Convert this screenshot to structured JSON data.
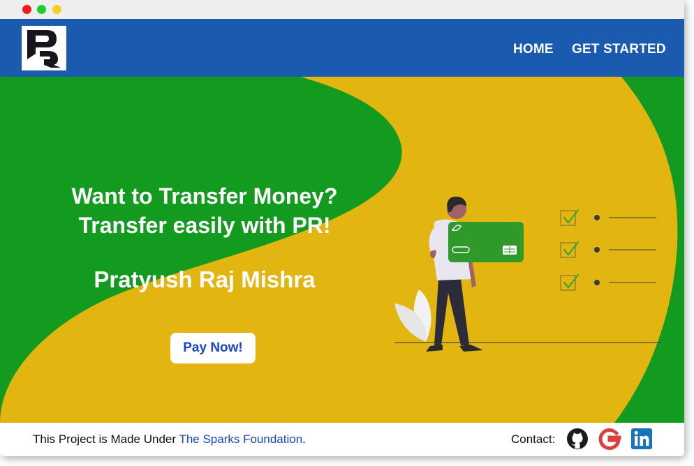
{
  "navbar": {
    "logo_alt": "PR",
    "links": [
      "HOME",
      "GET STARTED"
    ]
  },
  "hero": {
    "headline_line1": "Want to Transfer Money?",
    "headline_line2": "Transfer easily with PR!",
    "author": "Pratyush Raj Mishra",
    "cta": "Pay Now!"
  },
  "footer": {
    "text_prefix": "This Project is Made Under ",
    "link_text": "The Sparks Foundation",
    "text_suffix": ".",
    "contact_label": "Contact:",
    "social_icons": [
      "github-icon",
      "google-icon",
      "linkedin-icon"
    ]
  },
  "colors": {
    "navbar": "#1a5bb0",
    "hero_green": "#139b1f",
    "hero_yellow": "#e2b510",
    "link_blue": "#1747c9"
  }
}
